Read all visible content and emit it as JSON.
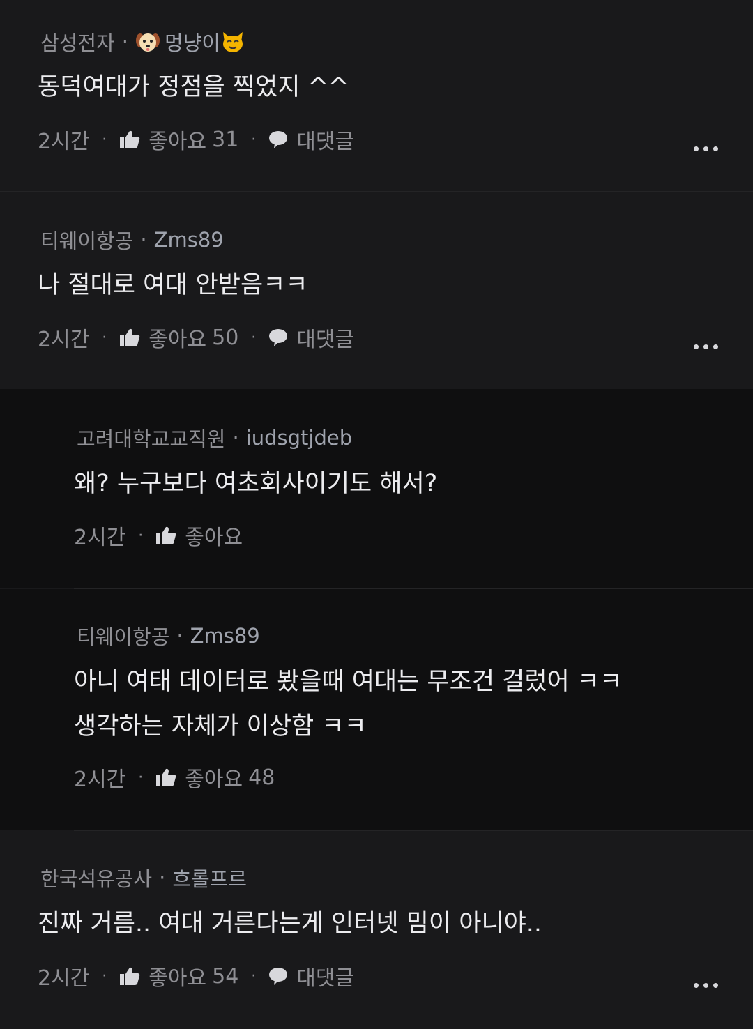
{
  "comments": [
    {
      "company": "삼성전자",
      "nick": "멍냥이",
      "text": "동덕여대가 정점을 찍었지 ^^",
      "time": "2시간",
      "like_label": "좋아요",
      "like_count": "31",
      "reply_label": "대댓글"
    },
    {
      "company": "티웨이항공",
      "nick": "Zms89",
      "text": "나 절대로 여대 안받음ㅋㅋ",
      "time": "2시간",
      "like_label": "좋아요",
      "like_count": "50",
      "reply_label": "대댓글"
    },
    {
      "company": "고려대학교교직원",
      "nick": "iudsgtjdeb",
      "text": "왜? 누구보다 여초회사이기도 해서?",
      "time": "2시간",
      "like_label": "좋아요",
      "like_count": ""
    },
    {
      "company": "티웨이항공",
      "nick": "Zms89",
      "text_line1": "아니 여태 데이터로 봤을때 여대는 무조건 걸렀어 ㅋㅋ",
      "text_line2": "생각하는 자체가 이상함 ㅋㅋ",
      "time": "2시간",
      "like_label": "좋아요",
      "like_count": "48"
    },
    {
      "company": "한국석유공사",
      "nick": "흐롤프르",
      "text": "진짜 거름.. 여대 거른다는게 인터넷 밈이 아니야..",
      "time": "2시간",
      "like_label": "좋아요",
      "like_count": "54",
      "reply_label": "대댓글"
    }
  ],
  "separator": "·",
  "icons": {
    "like": "thumbs-up-icon",
    "reply": "speech-bubble-icon",
    "more": "more-dots-icon"
  },
  "colors": {
    "background": "#19191b",
    "reply_background": "#0f0f10",
    "text": "#ececef",
    "meta": "#8f8f94"
  }
}
